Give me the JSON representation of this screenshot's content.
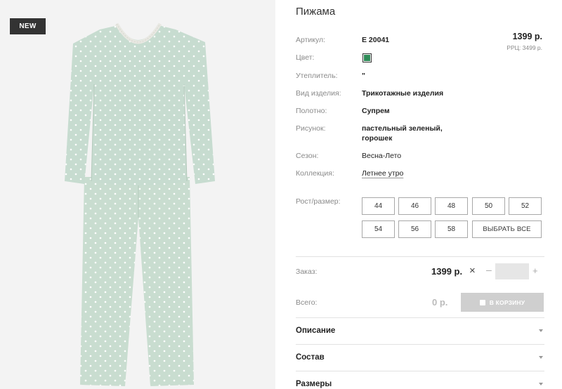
{
  "product": {
    "title": "Пижама",
    "badge": "NEW",
    "price": "1399 р.",
    "rrp": "РРЦ: 3499 р.",
    "attributes": [
      {
        "label": "Артикул:",
        "value": "E 20041"
      },
      {
        "label": "Цвет:",
        "value": ""
      },
      {
        "label": "Утеплитель:",
        "value": "\""
      },
      {
        "label": "Вид изделия:",
        "value": "Трикотажные изделия"
      },
      {
        "label": "Полотно:",
        "value": "Супрем"
      },
      {
        "label": "Рисунок:",
        "value": "пастельный зеленый, горошек"
      },
      {
        "label": "Сезон:",
        "value": "Весна-Лето"
      },
      {
        "label": "Коллекция:",
        "value": "Летнее утро"
      }
    ],
    "color_swatch": "#2e8b57"
  },
  "sizes": {
    "label": "Рост/размер:",
    "options": [
      "44",
      "46",
      "48",
      "50",
      "52",
      "54",
      "56",
      "58"
    ],
    "select_all": "ВЫБРАТЬ ВСЕ"
  },
  "order": {
    "label": "Заказ:",
    "price": "1399 р.",
    "multiply": "×",
    "minus": "–",
    "plus": "+",
    "quantity": ""
  },
  "total": {
    "label": "Всего:",
    "value": "0 р.",
    "cart_button": "В КОРЗИНУ"
  },
  "accordions": [
    "Описание",
    "Состав",
    "Размеры"
  ],
  "icons": {
    "bag": "shopping-bag-icon",
    "chevron": "chevron-down-icon",
    "times": "times-icon"
  }
}
